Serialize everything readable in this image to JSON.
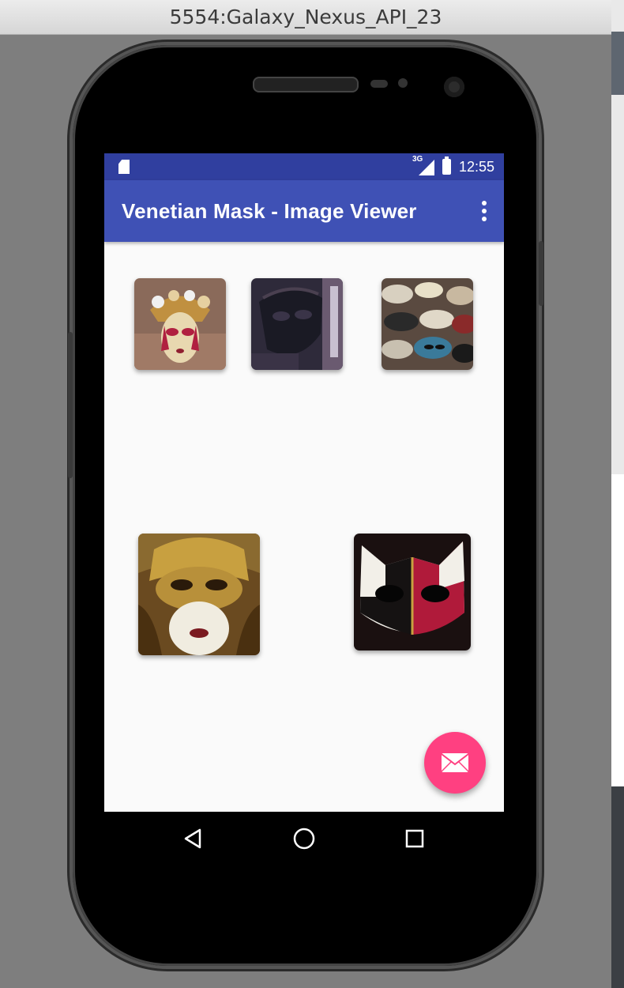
{
  "window": {
    "title": "5554:Galaxy_Nexus_API_23"
  },
  "status_bar": {
    "network": "3G",
    "time": "12:55"
  },
  "app_bar": {
    "title": "Venetian Mask - Image Viewer",
    "menu_icon": "overflow-menu-icon"
  },
  "gallery": {
    "images": [
      {
        "name": "mask-image-1",
        "colors": [
          "#8a6a5a",
          "#b02040",
          "#e8d8b0"
        ]
      },
      {
        "name": "mask-image-2",
        "colors": [
          "#2e2a3a",
          "#1a1a24",
          "#6a5a70"
        ]
      },
      {
        "name": "mask-image-3",
        "colors": [
          "#5a4a40",
          "#d8d0c0",
          "#3a7a9a"
        ]
      },
      {
        "name": "mask-image-4",
        "colors": [
          "#6a4a20",
          "#c8a040",
          "#f0ece0"
        ]
      },
      {
        "name": "mask-image-5",
        "colors": [
          "#1a1010",
          "#b01a3a",
          "#f2efe8"
        ]
      }
    ]
  },
  "fab": {
    "icon": "email-icon",
    "color": "#ff4081"
  },
  "nav_bar": {
    "back_icon": "back-icon",
    "home_icon": "home-icon",
    "recents_icon": "recents-icon"
  },
  "colors": {
    "primary": "#3f51b5",
    "primary_dark": "#303f9f",
    "accent": "#ff4081"
  }
}
